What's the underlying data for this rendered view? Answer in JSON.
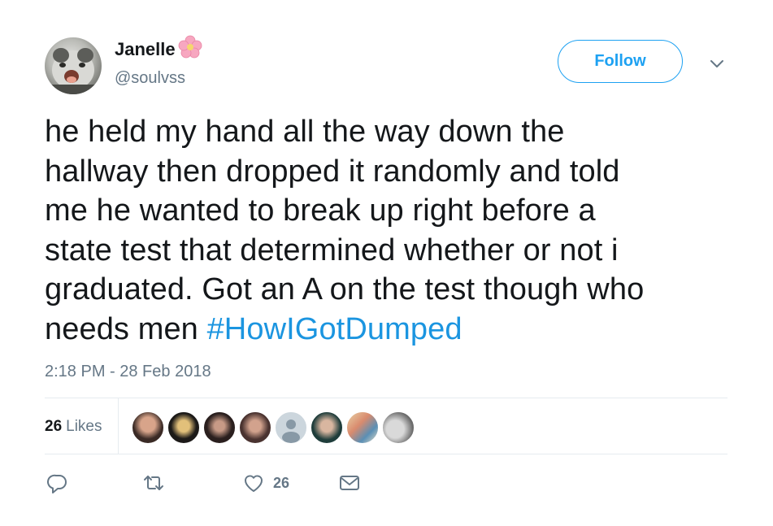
{
  "user": {
    "display_name": "Janelle",
    "handle": "@soulvss"
  },
  "header": {
    "follow_label": "Follow"
  },
  "tweet": {
    "lines": [
      "he held my hand all the way down the",
      "hallway then dropped it randomly and told",
      "me he wanted to break up right before a",
      "state test that determined whether or not i",
      "graduated. Got an A on the test though who",
      "needs men "
    ],
    "hashtag": "#HowIGotDumped",
    "timestamp": "2:18 PM - 28 Feb 2018"
  },
  "stats": {
    "likes_count": "26",
    "likes_label": "Likes"
  },
  "actions": {
    "like_count": "26"
  },
  "colors": {
    "accent": "#1da1f2",
    "hashtag": "#1b95e0",
    "secondary_text": "#657786"
  },
  "icons": [
    "flower-icon",
    "chevron-down-icon",
    "reply-icon",
    "retweet-icon",
    "heart-icon",
    "message-icon"
  ]
}
